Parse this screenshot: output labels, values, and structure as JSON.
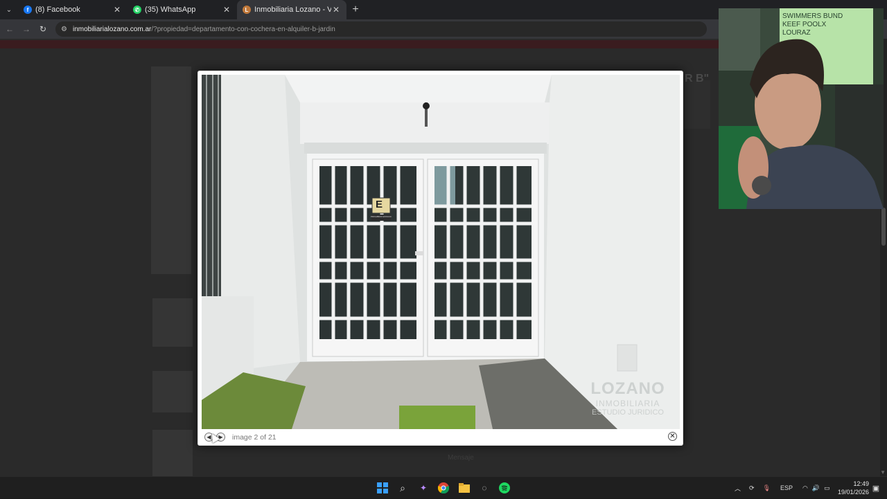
{
  "browser": {
    "tabs": [
      {
        "title": "(8) Facebook",
        "favicon": "facebook-icon",
        "color": "#1877f2",
        "active": false
      },
      {
        "title": "(35) WhatsApp",
        "favicon": "whatsapp-icon",
        "color": "#25d366",
        "active": false
      },
      {
        "title": "Inmobiliaria Lozano - Venta y A",
        "favicon": "lozano-icon",
        "color": "#c0783a",
        "active": true
      }
    ],
    "url_host": "inmobiliarialozano.com.ar",
    "url_path": "/?propiedad=departamento-con-cochera-en-alquiler-b-jardin"
  },
  "page_behind": {
    "heading_fragment": "R B\"",
    "footer_fragment": "Mensaje"
  },
  "lightbox": {
    "counter": "image 2 of 21",
    "photo_watermark_top": "LOZANO",
    "photo_watermark_line2": "INMOBILIARIA",
    "photo_watermark_line3": "ESTUDIO JURIDICO",
    "sign_letter": "E",
    "sign_caption": "PROHIBIDO ESTACIONAR"
  },
  "webcam": {
    "wall_text": [
      "SWIMMERS BUND",
      "KEEF POOLX",
      "LOURAZ"
    ]
  },
  "taskbar": {
    "language": "ESP",
    "time": "12:49",
    "date": "19/01/2026"
  },
  "colors": {
    "accent_red_bar": "#3a1c1f",
    "overlay_bg": "#1b1b1b"
  }
}
